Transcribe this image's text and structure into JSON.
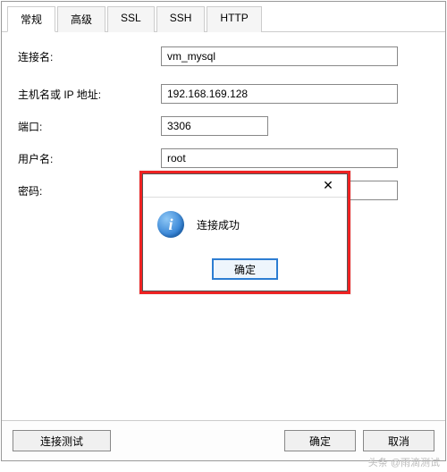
{
  "tabs": {
    "t0": "常规",
    "t1": "高级",
    "t2": "SSL",
    "t3": "SSH",
    "t4": "HTTP"
  },
  "labels": {
    "connName": "连接名:",
    "host": "主机名或 IP 地址:",
    "port": "端口:",
    "user": "用户名:",
    "password": "密码:"
  },
  "values": {
    "connName": "vm_mysql",
    "host": "192.168.169.128",
    "port": "3306",
    "user": "root",
    "password": "•••••••"
  },
  "buttons": {
    "test": "连接测试",
    "ok": "确定",
    "cancel": "取消"
  },
  "dialog": {
    "message": "连接成功",
    "ok": "确定",
    "close": "✕"
  },
  "watermark": "头条 @雨滴测试"
}
